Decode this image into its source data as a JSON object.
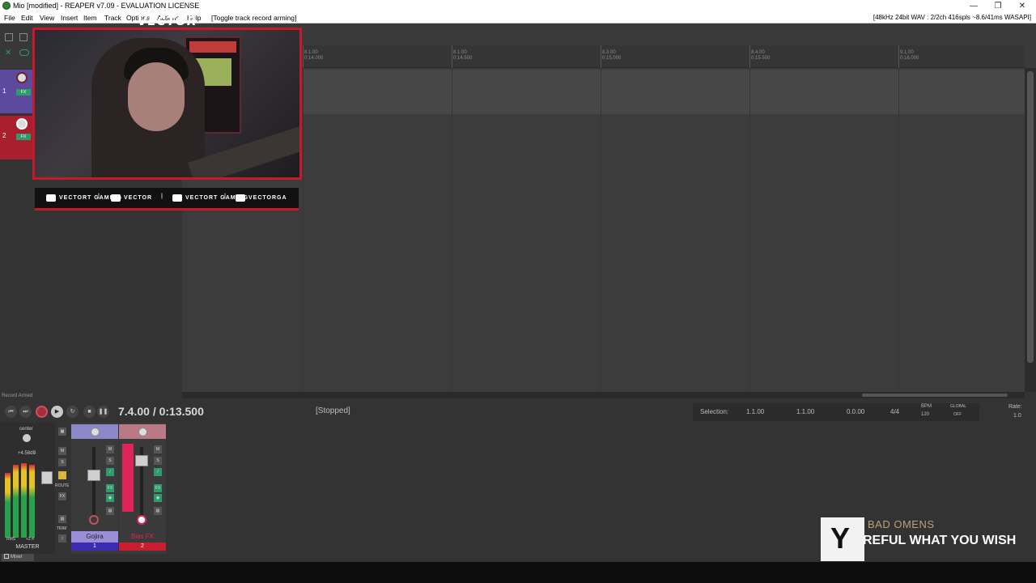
{
  "window": {
    "title": "Mio [modified] - REAPER v7.09 - EVALUATION LICENSE",
    "controls": [
      "—",
      "❐",
      "✕"
    ]
  },
  "menu": {
    "items": [
      "File",
      "Edit",
      "View",
      "Insert",
      "Item",
      "Track",
      "Options",
      "Actions",
      "Help"
    ],
    "action_hint": "[Toggle track record arming]",
    "audio_status": "[48kHz 24bit WAV : 2/2ch 416spls ~8.6/41ms WASAPI]"
  },
  "ruler": {
    "marks": [
      {
        "bar": "8.1.00",
        "time": "0:14.000"
      },
      {
        "bar": "8.1.00",
        "time": "0:14.500"
      },
      {
        "bar": "8.3.00",
        "time": "0:15.000"
      },
      {
        "bar": "8.4.00",
        "time": "0:15.500"
      },
      {
        "bar": "9.1.00",
        "time": "0:16.000"
      }
    ]
  },
  "tracks": [
    {
      "number": "1",
      "color": "#5c4a9e"
    },
    {
      "number": "2",
      "color": "#a91f2d"
    }
  ],
  "overlay": {
    "brand": "VECTOR",
    "social": [
      {
        "icon": "youtube-icon",
        "label": "VECTORT GAMING"
      },
      {
        "icon": "twitch-icon",
        "label": "VECTOR"
      },
      {
        "icon": "twitter-icon",
        "label": "VECTORT GAMING"
      },
      {
        "icon": "instagram-icon",
        "label": "VECTORGA"
      }
    ],
    "separator": "|",
    "accent": "#c61a2a"
  },
  "status": {
    "record_armed": "Record Armed",
    "timecode": "7.4.00 / 0:13.500",
    "play_state": "[Stopped]"
  },
  "selection": {
    "label": "Selection:",
    "start": "1.1.00",
    "end": "1.1.00",
    "length": "0.0.00",
    "time_sig": "4/4",
    "bpm_label": "BPM",
    "bpm": "120",
    "global_label": "GLOBAL",
    "global_state": "OFF",
    "rate_label": "Rate:",
    "rate": "1.0"
  },
  "mixer": {
    "master": {
      "label": "MASTER",
      "pan": "center",
      "peak": "+4.58dB",
      "rms_label": "RMS",
      "rms": "+2.4",
      "route": "ROUTE",
      "trim": "TRIM"
    },
    "channels": [
      {
        "name": "Gojira",
        "number": "1",
        "color": "#3b2bb0",
        "name_bg": "#9a8fd6"
      },
      {
        "name": "Bias FX",
        "number": "2",
        "color": "#c81e30",
        "name_bg": "#3a3a3a"
      }
    ],
    "tab": "Mixer"
  },
  "now_playing": {
    "band": "BAD OMENS",
    "song": "REFUL WHAT YOU WISH"
  }
}
